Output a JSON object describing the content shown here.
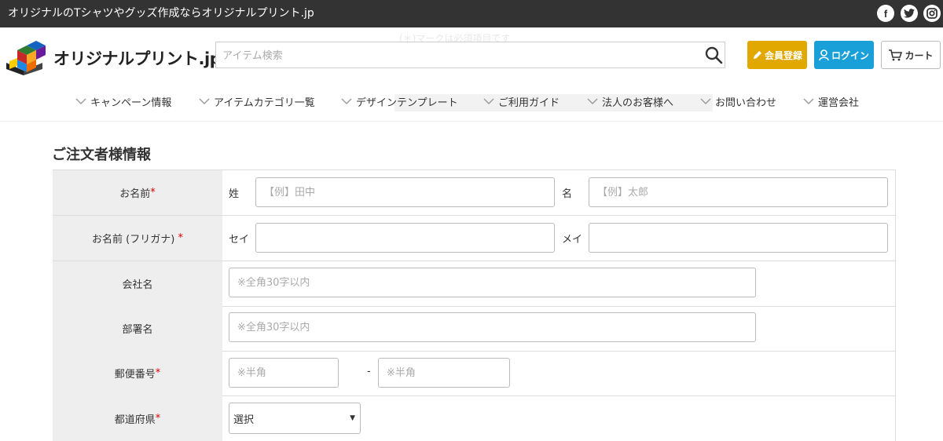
{
  "topbar": {
    "tagline": "オリジナルのTシャツやグッズ作成ならオリジナルプリント.jp",
    "social": [
      {
        "icon": "facebook-icon",
        "glyph": "f"
      },
      {
        "icon": "twitter-icon",
        "glyph": "t"
      },
      {
        "icon": "instagram-icon",
        "glyph": "◎"
      }
    ]
  },
  "ghost": {
    "line1": "(＊)マークは必須項目です",
    "line2": "…"
  },
  "header": {
    "logo_text": "オリジナルプリント.jp",
    "search": {
      "placeholder": "アイテム検索",
      "value": ""
    },
    "register_label": "会員登録",
    "login_label": "ログイン",
    "cart_label": "カート",
    "colors": {
      "register": "#e0a800",
      "login": "#1aa0d8"
    }
  },
  "nav": {
    "items": [
      {
        "label": "キャンペーン情報"
      },
      {
        "label": "アイテムカテゴリ一覧"
      },
      {
        "label": "デザインテンプレート"
      },
      {
        "label": "ご利用ガイド"
      },
      {
        "label": "法人のお客様へ"
      },
      {
        "label": "お問い合わせ"
      },
      {
        "label": "運営会社"
      }
    ]
  },
  "form": {
    "title": "ご注文者様情報",
    "required_mark": "*",
    "name": {
      "label": "お名前",
      "last_label": "姓",
      "last_placeholder": "【例】田中",
      "last_value": "",
      "first_label": "名",
      "first_placeholder": "【例】太郎",
      "first_value": ""
    },
    "kana": {
      "label": "お名前 (フリガナ) ",
      "last_label": "セイ",
      "last_value": "",
      "first_label": "メイ",
      "first_value": ""
    },
    "company": {
      "label": "会社名",
      "placeholder": "※全角30字以内",
      "value": ""
    },
    "department": {
      "label": "部署名",
      "placeholder": "※全角30字以内",
      "value": ""
    },
    "postal": {
      "label": "郵便番号",
      "placeholder1": "※半角",
      "placeholder2": "※半角",
      "separator": "-",
      "value1": "",
      "value2": ""
    },
    "prefecture": {
      "label": "都道府県",
      "selected": "選択"
    }
  }
}
